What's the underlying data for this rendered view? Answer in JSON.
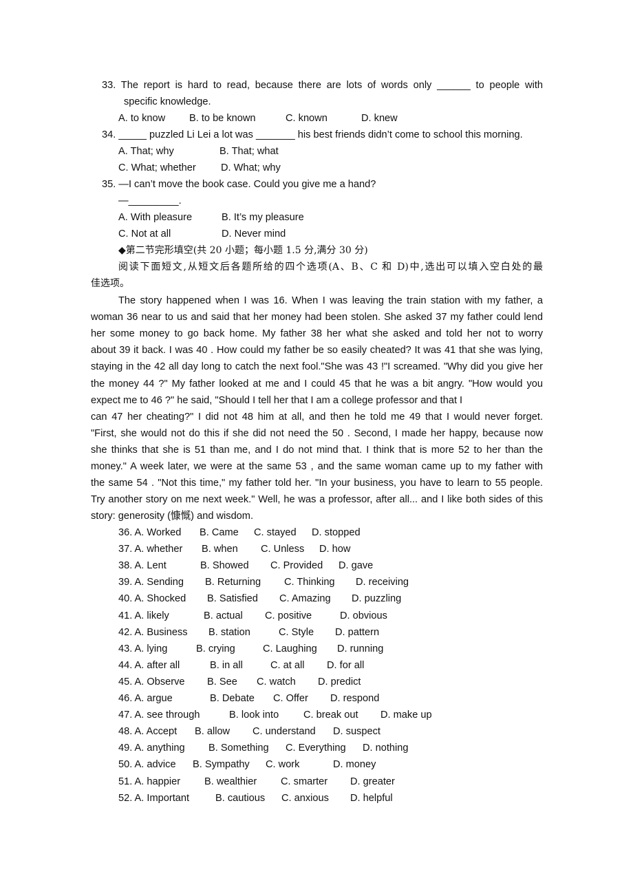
{
  "section1_tail": [
    {
      "number": "33.",
      "stem_line1": "The report is hard to read, because there are lots of words only ______ to people with",
      "stem_line2": "specific knowledge.",
      "options": [
        "A. to know",
        "B. to be known",
        "C. known",
        "D. knew"
      ]
    },
    {
      "number": "34.",
      "stem_line1": "_____ puzzled Li Lei a lot was _______ his best friends didn’t come to school this morning.",
      "options": [
        "A. That; why",
        "B. That; what",
        "C. What; whether",
        "D. What; why"
      ]
    },
    {
      "number": "35.",
      "stem_line1": "—I can’t move the book case. Could you give me a hand?",
      "stem_line2": "—_________.",
      "options": [
        "A. With pleasure",
        "B. It’s my pleasure",
        "C. Not at all",
        "D. Never mind"
      ]
    }
  ],
  "section2": {
    "heading": "◆第二节完形填空(共 20 小题；每小题 1.5 分,满分 30 分)",
    "instruction_line1": "阅读下面短文,从短文后各题所给的四个选项(A、B、C 和 D)中,选出可以填入空白处的最",
    "instruction_line2": "佳选项。",
    "passage_lines": [
      "The story happened when I was 16. When I was leaving the train station with my father, a",
      "woman 36 near to us and said that her money had been stolen. She asked 37 my father could lend",
      "her some money to go back home. My father 38 her what she asked and told her not to worry",
      "about 39 it back. I was 40 . How could my father be so easily cheated? It was 41 that she was lying,",
      "staying in the 42 all day long to catch the next fool.\"She was 43 !\"I screamed. \"Why did you give her",
      "the money 44 ?\" My father looked at me and I could 45 that he was a bit angry. \"How would you",
      "expect me to 46 ?\" he said,    \"Should I tell her that I am a college professor and that I",
      "can 47 her cheating?\" I did not 48 him at all, and then he told me 49 that I would never forget.",
      "\"First, she would not do this if she did not need the 50 . Second, I made her happy, because now",
      "she thinks that she is 51 than me, and I do not mind that. I think that is more 52 to her than the",
      "money.\" A week later, we were at the same 53 , and the same woman came up to my father with",
      "the same 54 . \"Not this time,\" my father told her. \"In your business, you have to learn to 55 people.",
      "Try another story on me next week.\" Well, he was a professor, after all... and I like both sides of this",
      "story: generosity (慷慨) and wisdom."
    ],
    "questions": [
      {
        "number": "36.",
        "options": [
          "A. Worked",
          "B. Came",
          "C. stayed",
          "D. stopped"
        ]
      },
      {
        "number": "37.",
        "options": [
          "A. whether",
          "B. when",
          "C. Unless",
          "D. how"
        ]
      },
      {
        "number": "38.",
        "options": [
          "A. Lent",
          "B. Showed",
          "C. Provided",
          "D. gave"
        ]
      },
      {
        "number": "39.",
        "options": [
          "A. Sending",
          "B. Returning",
          "C. Thinking",
          "D. receiving"
        ]
      },
      {
        "number": "40.",
        "options": [
          "A. Shocked",
          "B. Satisfied",
          "C. Amazing",
          "D. puzzling"
        ]
      },
      {
        "number": "41.",
        "options": [
          "A. likely",
          "B. actual",
          "C. positive",
          "D. obvious"
        ]
      },
      {
        "number": "42.",
        "options": [
          "A. Business",
          "B. station",
          "C. Style",
          "D. pattern"
        ]
      },
      {
        "number": "43.",
        "options": [
          "A. lying",
          "B. crying",
          "C. Laughing",
          "D. running"
        ]
      },
      {
        "number": "44.",
        "options": [
          "A. after all",
          "B. in all",
          "C. at all",
          "D. for all"
        ]
      },
      {
        "number": "45.",
        "options": [
          "A. Observe",
          "B. See",
          "C. watch",
          "D. predict"
        ]
      },
      {
        "number": "46.",
        "options": [
          "A. argue",
          "B. Debate",
          "C. Offer",
          "D. respond"
        ]
      },
      {
        "number": "47.",
        "options": [
          "A. see through",
          "B. look into",
          "C. break out",
          "D. make up"
        ]
      },
      {
        "number": "48.",
        "options": [
          "A. Accept",
          "B. allow",
          "C. understand",
          "D. suspect"
        ]
      },
      {
        "number": "49.",
        "options": [
          "A. anything",
          "B. Something",
          "C. Everything",
          "D. nothing"
        ]
      },
      {
        "number": "50.",
        "options": [
          "A. advice",
          "B. Sympathy",
          "C. work",
          "D. money"
        ]
      },
      {
        "number": "51.",
        "options": [
          "A. happier",
          "B. wealthier",
          "C. smarter",
          "D. greater"
        ]
      },
      {
        "number": "52.",
        "options": [
          "A. Important",
          "B. cautious",
          "C. anxious",
          "D. helpful"
        ]
      }
    ]
  }
}
